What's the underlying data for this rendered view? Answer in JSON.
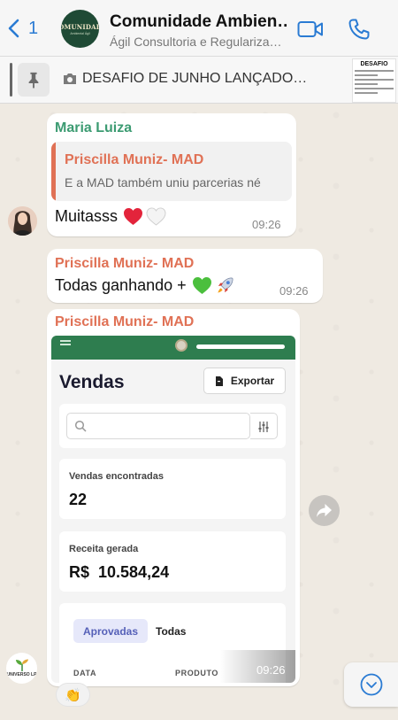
{
  "header": {
    "back_count": "1",
    "title": "Comunidade Ambien…",
    "subtitle": "Ágil Consultoria e Regulariza…",
    "avatar_line1": "COMUNIDADE",
    "avatar_line2": "Ambiental Ágil"
  },
  "pinned": {
    "text": "DESAFIO DE JUNHO LANÇADO…",
    "thumb_title": "DESAFIO"
  },
  "messages": [
    {
      "sender": "Maria Luiza",
      "quote_sender": "Priscilla Muniz- MAD",
      "quote_text": "E a MAD também uniu parcerias né",
      "text": "Muitasss",
      "time": "09:26"
    },
    {
      "sender": "Priscilla Muniz- MAD",
      "text": "Todas ganhando +",
      "time": "09:26"
    },
    {
      "sender": "Priscilla Muniz- MAD",
      "time": "09:26",
      "screenshot": {
        "heading": "Vendas",
        "export_label": "Exportar",
        "found_label": "Vendas encontradas",
        "found_value": "22",
        "revenue_label": "Receita gerada",
        "revenue_value": "R$  10.584,24",
        "tab_approved": "Aprovadas",
        "tab_all": "Todas",
        "col_date": "DATA",
        "col_product": "PRODUTO"
      }
    }
  ],
  "reaction": "👏",
  "avatar_logo_text": "UNIVERSO LP",
  "colors": {
    "accent": "#2a7bd3",
    "sender_green": "#3c9b72",
    "sender_orange": "#e07155"
  }
}
